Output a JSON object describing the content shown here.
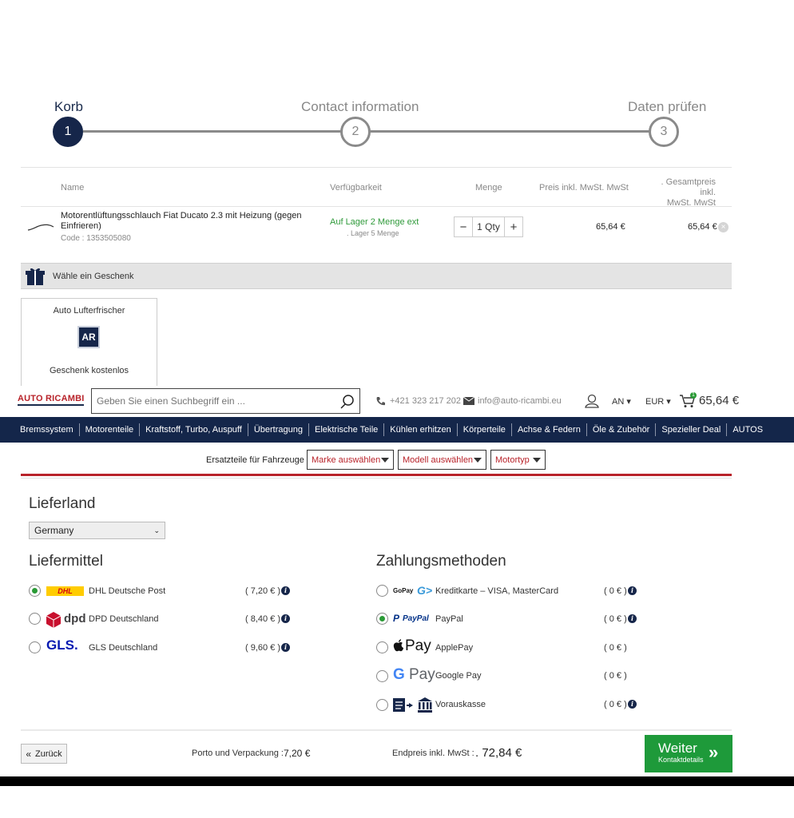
{
  "steps": [
    {
      "label": "Korb",
      "num": "1"
    },
    {
      "label": "Contact information",
      "num": "2"
    },
    {
      "label": "Daten prüfen",
      "num": "3"
    }
  ],
  "cart": {
    "headers": {
      "name": "Name",
      "availability": "Verfügbarkeit",
      "quantity": "Menge",
      "unit_price": "Preis inkl. MwSt. MwSt",
      "total_price_line1": ". Gesamtpreis inkl.",
      "total_price_line2": "MwSt. MwSt"
    },
    "item": {
      "name_line1": "Motorentlüftungsschlauch Fiat Ducato 2.3 mit Heizung (gegen",
      "name_line2": "Einfrieren)",
      "code": "Code : 1353505080",
      "stock_main": "Auf Lager 2 Menge ext",
      "stock_sub": ". Lager 5 Menge",
      "qty": "1 Qty",
      "unit_price": "65,64 €",
      "total_price": "65,64 €"
    }
  },
  "gift": {
    "bar_label": "Wähle ein Geschenk",
    "item_title": "Auto Lufterfrischer",
    "item_logo": "AR",
    "item_note": "Geschenk kostenlos"
  },
  "header": {
    "logo": "AUTO RICAMBI",
    "search_placeholder": "Geben Sie einen Suchbegriff ein ...",
    "phone": "+421 323 217 202",
    "email": "info@auto-ricambi.eu",
    "lang": "AN",
    "currency": "EUR",
    "cart_count": "1",
    "cart_total": "65,64 €"
  },
  "nav": [
    "Bremssystem",
    "Motorenteile",
    "Kraftstoff, Turbo, Auspuff",
    "Übertragung",
    "Elektrische Teile",
    "Kühlen erhitzen",
    "Körperteile",
    "Achse & Federn",
    "Öle & Zubehör",
    "Spezieller Deal",
    "AUTOS"
  ],
  "vehicle_filter": {
    "label": "Ersatzteile für Fahrzeuge",
    "make": "Marke auswählen",
    "model": "Modell auswählen",
    "engine": "Motortyp"
  },
  "delivery": {
    "country_title": "Lieferland",
    "country_value": "Germany",
    "shipping_title": "Liefermittel",
    "shipping": [
      {
        "logo": "DHL",
        "label": "DHL Deutsche Post",
        "price": "( 7,20 € )",
        "checked": true
      },
      {
        "logo": "dpd",
        "label": "DPD Deutschland",
        "price": "( 8,40 € )",
        "checked": false
      },
      {
        "logo": "GLS.",
        "label": "GLS Deutschland",
        "price": "( 9,60 € )",
        "checked": false
      }
    ],
    "payment_title": "Zahlungsmethoden",
    "payments": [
      {
        "logo": "GoPay",
        "label": "Kreditkarte – VISA, MasterCard",
        "price": "( 0 € )",
        "checked": false
      },
      {
        "logo": "PayPal",
        "label": "PayPal",
        "price": "( 0 € )",
        "checked": true
      },
      {
        "logo": "Pay",
        "label": "ApplePay",
        "price": "( 0 € )",
        "checked": false
      },
      {
        "logo": "Pay",
        "label": "Google Pay",
        "price": "( 0 € )",
        "checked": false
      },
      {
        "logo": "",
        "label": "Vorauskasse",
        "price": "( 0 € )",
        "checked": false
      }
    ]
  },
  "footer": {
    "back": "Zurück",
    "shipping_cost_label": "Porto und Verpackung :",
    "shipping_cost_value": "7,20 €",
    "final_label": "Endpreis inkl. MwSt :",
    "final_value": ". 72,84 €",
    "next_main": "Weiter",
    "next_sub": "Kontaktdetails"
  },
  "colors": {
    "navy": "#14264a",
    "red": "#b8232a",
    "green": "#1e9a3a"
  }
}
